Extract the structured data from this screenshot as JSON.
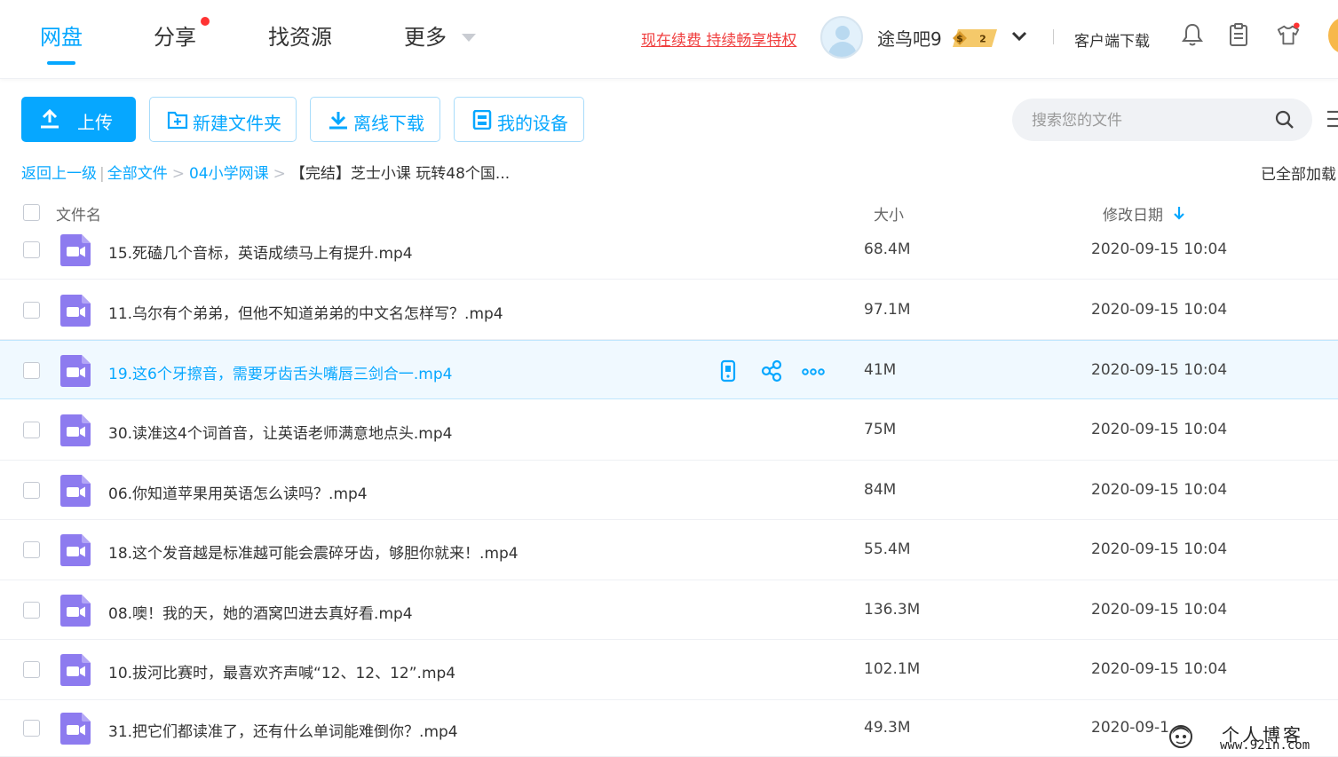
{
  "nav": {
    "tabs": [
      "网盘",
      "分享",
      "找资源",
      "更多"
    ],
    "vip_link": "现在续费 持续畅享特权",
    "username": "途鸟吧9",
    "svip_level": "2",
    "client_download": "客户端下载"
  },
  "toolbar": {
    "upload": "上传",
    "new_folder": "新建文件夹",
    "offline_download": "离线下载",
    "my_devices": "我的设备"
  },
  "search": {
    "placeholder": "搜索您的文件"
  },
  "breadcrumb": {
    "back": "返回上一级",
    "all_files": "全部文件",
    "folder": "04小学网课",
    "current": "【完结】芝士小课 玩转48个国..."
  },
  "loaded_status": "已全部加载",
  "table": {
    "headers": {
      "name": "文件名",
      "size": "大小",
      "modified": "修改日期"
    },
    "rows": [
      {
        "name": "15.死磕几个音标，英语成绩马上有提升.mp4",
        "size": "68.4M",
        "modified": "2020-09-15 10:04"
      },
      {
        "name": "11.乌尔有个弟弟，但他不知道弟弟的中文名怎样写？.mp4",
        "size": "97.1M",
        "modified": "2020-09-15 10:04"
      },
      {
        "name": "19.这6个牙擦音，需要牙齿舌头嘴唇三剑合一.mp4",
        "size": "41M",
        "modified": "2020-09-15 10:04"
      },
      {
        "name": "30.读准这4个词首音，让英语老师满意地点头.mp4",
        "size": "75M",
        "modified": "2020-09-15 10:04"
      },
      {
        "name": "06.你知道苹果用英语怎么读吗？.mp4",
        "size": "84M",
        "modified": "2020-09-15 10:04"
      },
      {
        "name": "18.这个发音越是标准越可能会震碎牙齿，够胆你就来！.mp4",
        "size": "55.4M",
        "modified": "2020-09-15 10:04"
      },
      {
        "name": "08.噢！我的天，她的酒窝凹进去真好看.mp4",
        "size": "136.3M",
        "modified": "2020-09-15 10:04"
      },
      {
        "name": "10.拔河比赛时，最喜欢齐声喊“12、12、12”.mp4",
        "size": "102.1M",
        "modified": "2020-09-15 10:04"
      },
      {
        "name": "31.把它们都读准了，还有什么单词能难倒你？.mp4",
        "size": "49.3M",
        "modified": "2020-09-1"
      }
    ]
  },
  "watermark": {
    "line1": "个人博客",
    "line2": "www.92in.com"
  },
  "colors": {
    "accent": "#06a7ff",
    "vip_red": "#f03e3e",
    "video_icon": "#8d7bef",
    "hover_row": "#f0f9ff"
  }
}
